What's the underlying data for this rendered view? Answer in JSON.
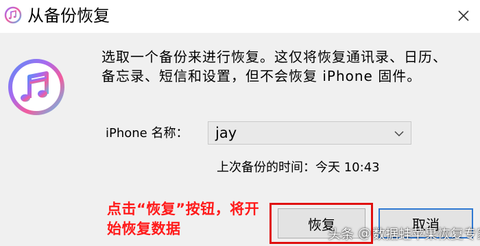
{
  "window": {
    "title": "从备份恢复",
    "icon": "itunes-music-note-icon",
    "close_icon": "close-x-icon"
  },
  "dialog": {
    "message": "选取一个备份来进行恢复。这仅将恢复通讯录、日历、备忘录、短信和设置，但不会恢复 iPhone 固件。",
    "app_icon": "itunes-music-note-icon",
    "device_label": "iPhone 名称：",
    "device_select": {
      "value": "jay",
      "icon": "chevron-down-icon"
    },
    "last_backup": "上次备份的时间：今天 10:43",
    "buttons": {
      "restore": "恢复",
      "cancel": "取消"
    }
  },
  "annotation": {
    "text": "点击“恢复”按钮，将开始恢复数据",
    "color": "#ff1a1a",
    "highlight_color": "#e0100f"
  },
  "watermark": {
    "brand": "头条",
    "at": "@",
    "account": "数据蛙苹果恢复专家"
  },
  "colors": {
    "dialog_background": "#f0f0f0",
    "title_background": "#ffffff",
    "default_button_border": "#2e78d2"
  }
}
